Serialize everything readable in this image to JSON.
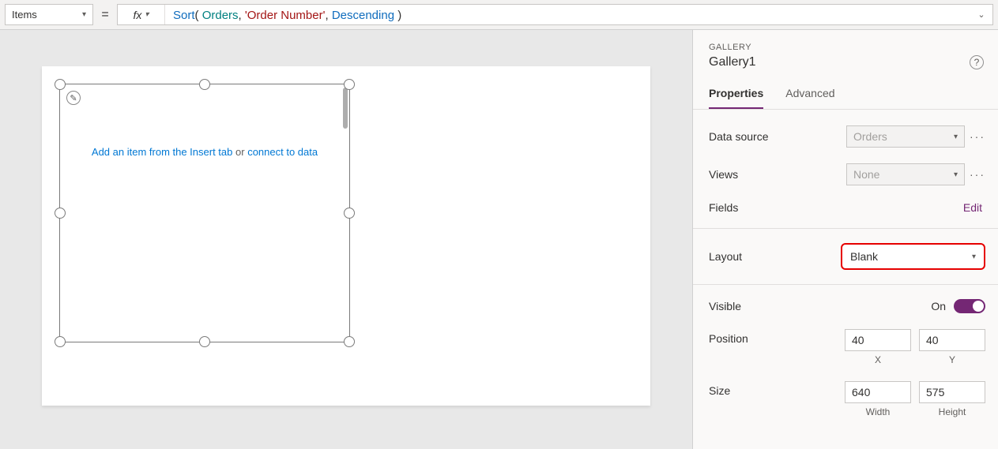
{
  "topbar": {
    "property": "Items",
    "equals": "=",
    "fx": "fx",
    "formula": {
      "fn": "Sort",
      "open": "( ",
      "ds": "Orders",
      "c1": ", ",
      "col": "'Order Number'",
      "c2": ", ",
      "order": "Descending",
      "close": " )"
    }
  },
  "canvas": {
    "hint_link1": "Add an item from the Insert tab",
    "hint_mid": " or ",
    "hint_link2": "connect to data"
  },
  "panel": {
    "type": "GALLERY",
    "name": "Gallery1",
    "tabs": {
      "properties": "Properties",
      "advanced": "Advanced"
    },
    "rows": {
      "data_source": {
        "label": "Data source",
        "value": "Orders"
      },
      "views": {
        "label": "Views",
        "value": "None"
      },
      "fields": {
        "label": "Fields",
        "action": "Edit"
      },
      "layout": {
        "label": "Layout",
        "value": "Blank"
      },
      "visible": {
        "label": "Visible",
        "state": "On"
      },
      "position": {
        "label": "Position",
        "x": "40",
        "y": "40",
        "xl": "X",
        "yl": "Y"
      },
      "size": {
        "label": "Size",
        "w": "640",
        "h": "575",
        "wl": "Width",
        "hl": "Height"
      }
    }
  }
}
